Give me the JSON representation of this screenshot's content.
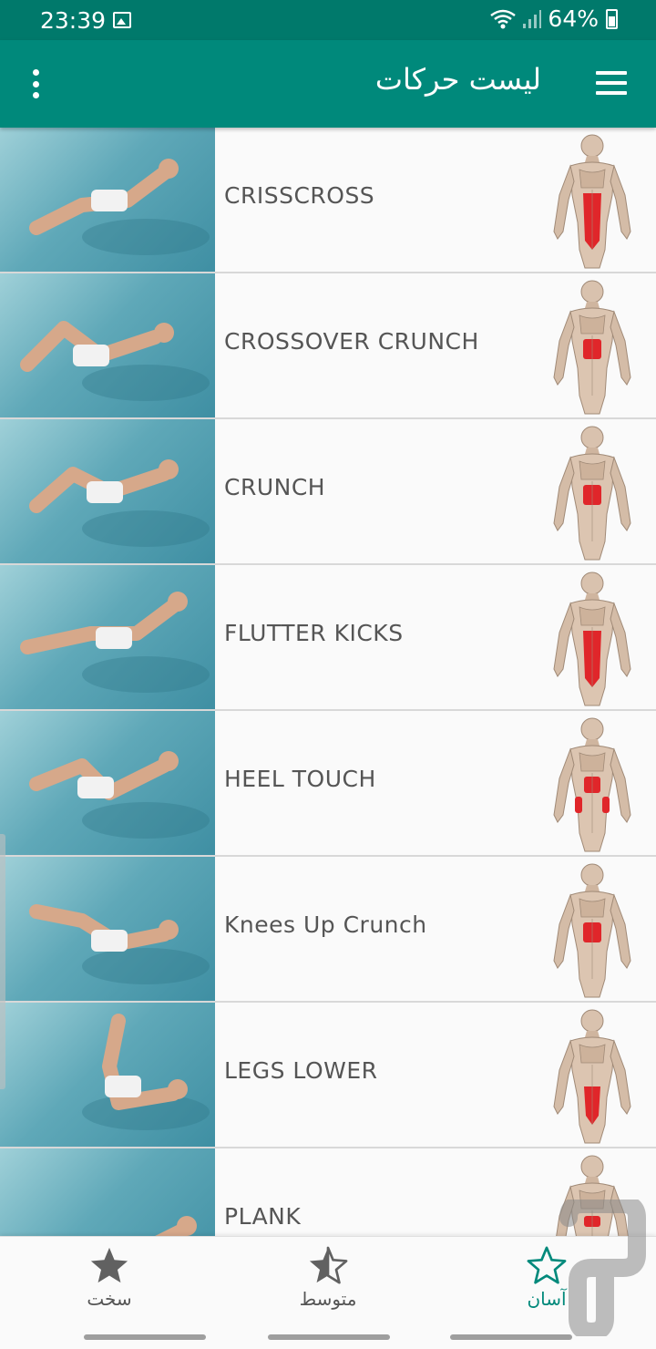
{
  "status_bar": {
    "time": "23:39",
    "battery": "64%",
    "icons": [
      "image-icon",
      "wifi-icon",
      "signal-icon",
      "battery-icon"
    ]
  },
  "app_bar": {
    "title": "لیست حرکات",
    "menu_icon": "hamburger-icon",
    "overflow_icon": "more-vert-icon",
    "background": "#00897b"
  },
  "exercises": [
    {
      "label": "CRISSCROSS",
      "highlight": "full-abs"
    },
    {
      "label": "CROSSOVER CRUNCH",
      "highlight": "upper-abs"
    },
    {
      "label": "CRUNCH",
      "highlight": "upper-abs"
    },
    {
      "label": "FLUTTER KICKS",
      "highlight": "full-abs"
    },
    {
      "label": "HEEL TOUCH",
      "highlight": "obliques"
    },
    {
      "label": "Knees Up Crunch",
      "highlight": "upper-abs"
    },
    {
      "label": "LEGS LOWER",
      "highlight": "lower-abs"
    },
    {
      "label": "PLANK",
      "highlight": "mid-abs"
    }
  ],
  "bottom_nav": {
    "items": [
      {
        "label": "سخت",
        "icon": "star-filled-icon",
        "active": false
      },
      {
        "label": "متوسط",
        "icon": "star-half-icon",
        "active": false
      },
      {
        "label": "آسان",
        "icon": "star-outline-icon",
        "active": true
      }
    ],
    "accent": "#00897b"
  }
}
